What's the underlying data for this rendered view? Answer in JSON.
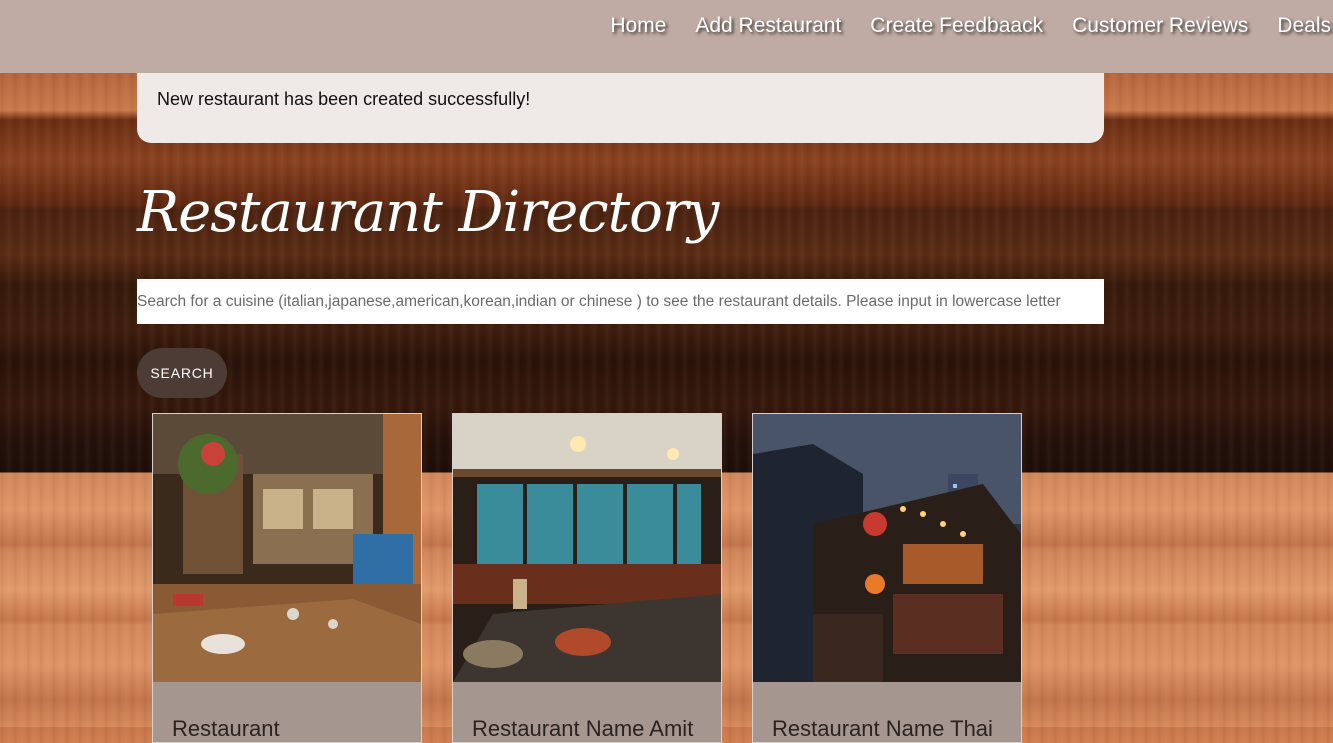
{
  "nav": {
    "links": [
      "Home",
      "Add Restaurant",
      "Create Feedbaack",
      "Customer Reviews",
      "Deals"
    ]
  },
  "alert": {
    "message": "New restaurant has been created successfully!"
  },
  "page": {
    "title": "Restaurant Directory"
  },
  "search": {
    "placeholder": "Search for a cuisine (italian,japanese,american,korean,indian or chinese ) to see the restaurant details. Please input in lowercase letter",
    "value": "",
    "button_label": "SEARCH"
  },
  "cards": [
    {
      "title": "Restaurant"
    },
    {
      "title": "Restaurant Name Amit"
    },
    {
      "title": "Restaurant Name Thai"
    }
  ]
}
